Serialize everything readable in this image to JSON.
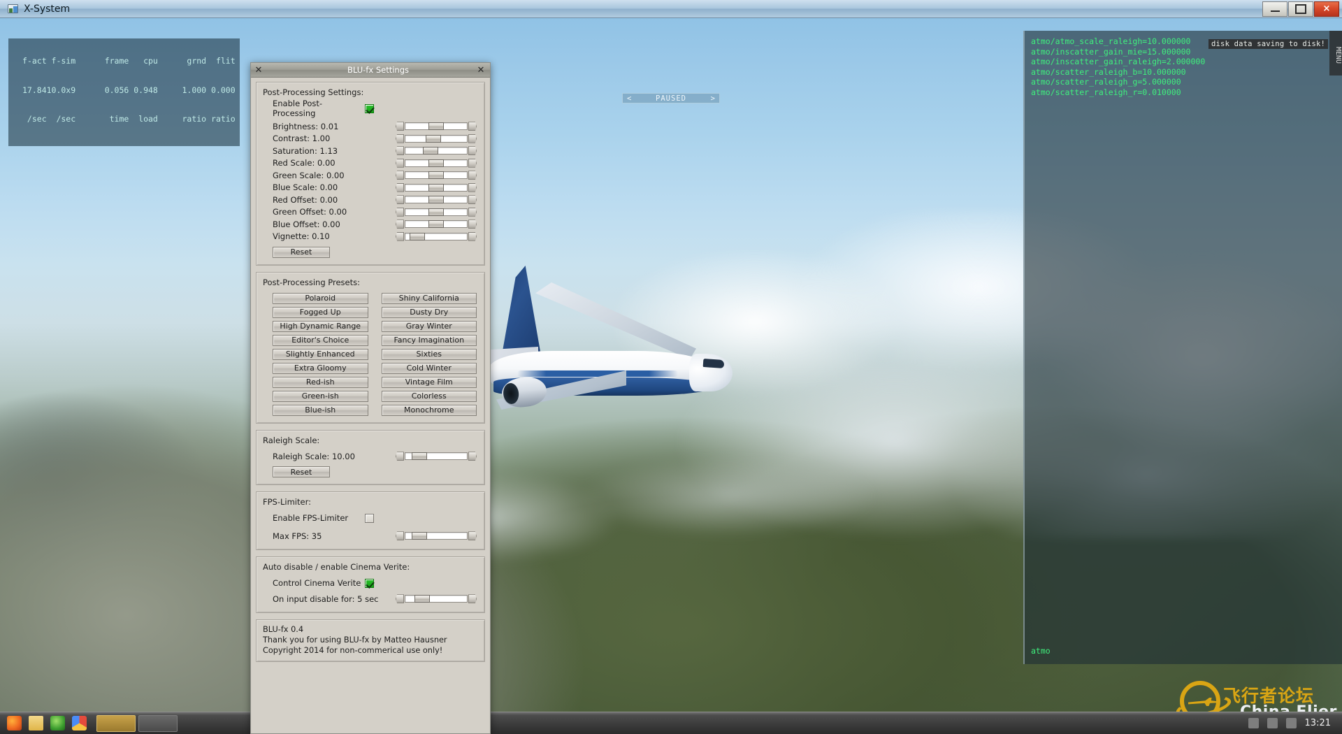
{
  "window": {
    "title": "X-System",
    "icon": "app-icon",
    "controls": {
      "minimize": "minimize-icon",
      "maximize": "maximize-icon",
      "close": "×"
    }
  },
  "hud": {
    "line1": "f-act f-sim      frame   cpu      grnd  flit",
    "line2": "17.8410.0x9      0.056 0.948     1.000 0.000",
    "line3": " /sec  /sec       time  load     ratio ratio"
  },
  "paused": {
    "left": "<",
    "label": "PAUSED",
    "right": ">"
  },
  "console": {
    "lines": [
      "atmo/atmo_scale_raleigh=10.000000",
      "atmo/inscatter_gain_mie=15.000000",
      "atmo/inscatter_gain_raleigh=2.000000",
      "atmo/scatter_raleigh_b=10.000000",
      "atmo/scatter_raleigh_g=5.000000",
      "atmo/scatter_raleigh_r=0.010000"
    ],
    "toast": "disk data saving to disk!",
    "footer": "atmo",
    "menu_tab": "MENU"
  },
  "watermark": {
    "cn": "飞行者论坛",
    "en": "China Flier"
  },
  "taskbar": {
    "clock": "13:21",
    "tasks": [
      {
        "label": "",
        "active": true
      },
      {
        "label": "",
        "active": false
      }
    ]
  },
  "dialog": {
    "title": "BLU-fx Settings",
    "close_left": "✕",
    "close_right": "✕",
    "post_processing": {
      "group_title": "Post-Processing Settings:",
      "enable_label": "Enable Post-Processing",
      "enable_checked": true,
      "sliders": [
        {
          "label": "Brightness: 0.01",
          "value": 0.01,
          "pos": 0.5
        },
        {
          "label": "Contrast: 1.00",
          "value": 1.0,
          "pos": 0.44
        },
        {
          "label": "Saturation: 1.13",
          "value": 1.13,
          "pos": 0.38
        },
        {
          "label": "Red Scale: 0.00",
          "value": 0.0,
          "pos": 0.5
        },
        {
          "label": "Green Scale: 0.00",
          "value": 0.0,
          "pos": 0.5
        },
        {
          "label": "Blue Scale: 0.00",
          "value": 0.0,
          "pos": 0.5
        },
        {
          "label": "Red Offset: 0.00",
          "value": 0.0,
          "pos": 0.5
        },
        {
          "label": "Green Offset: 0.00",
          "value": 0.0,
          "pos": 0.5
        },
        {
          "label": "Blue Offset: 0.00",
          "value": 0.0,
          "pos": 0.5
        },
        {
          "label": "Vignette: 0.10",
          "value": 0.1,
          "pos": 0.1
        }
      ],
      "reset_label": "Reset"
    },
    "presets": {
      "group_title": "Post-Processing Presets:",
      "items": [
        "Polaroid",
        "Shiny California",
        "Fogged Up",
        "Dusty Dry",
        "High Dynamic Range",
        "Gray Winter",
        "Editor's Choice",
        "Fancy Imagination",
        "Slightly Enhanced",
        "Sixties",
        "Extra Gloomy",
        "Cold Winter",
        "Red-ish",
        "Vintage Film",
        "Green-ish",
        "Colorless",
        "Blue-ish",
        "Monochrome"
      ]
    },
    "raleigh": {
      "group_title": "Raleigh Scale:",
      "slider_label": "Raleigh Scale: 10.00",
      "slider_value": 10.0,
      "slider_pos": 0.1,
      "reset_label": "Reset"
    },
    "fps_limiter": {
      "group_title": "FPS-Limiter:",
      "enable_label": "Enable FPS-Limiter",
      "enable_checked": false,
      "slider_label": "Max FPS: 35",
      "slider_value": 35,
      "slider_pos": 0.1
    },
    "cinema_verite": {
      "group_title": "Auto disable / enable Cinema Verite:",
      "control_label": "Control Cinema Verite",
      "control_checked": true,
      "slider_label": "On input disable for: 5 sec",
      "slider_value": 5,
      "slider_pos": 0.14
    },
    "about": {
      "line1": "BLU-fx 0.4",
      "line2": "Thank you for using BLU-fx by Matteo Hausner",
      "line3": "Copyright 2014 for non-commerical use only!"
    }
  }
}
